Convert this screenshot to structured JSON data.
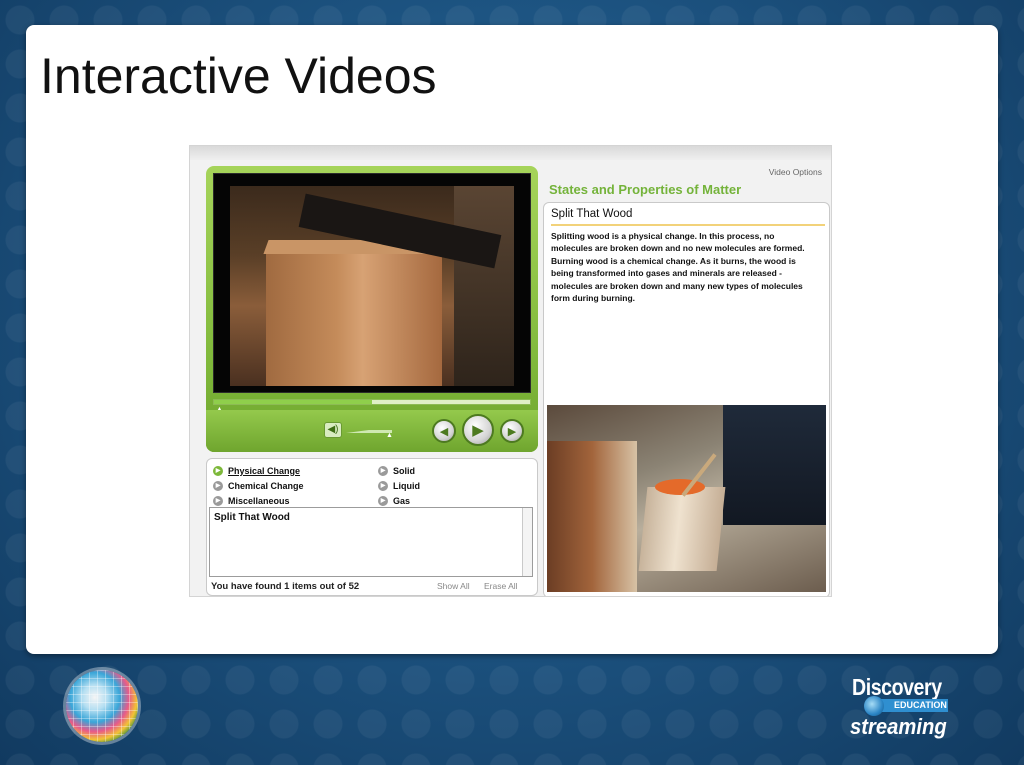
{
  "slide": {
    "title": "Interactive Videos"
  },
  "player": {
    "progress_fraction": 0.5,
    "chapters": [
      {
        "label": "Physical Change",
        "active": true
      },
      {
        "label": "Solid",
        "active": false
      },
      {
        "label": "Chemical Change",
        "active": false
      },
      {
        "label": "Liquid",
        "active": false
      },
      {
        "label": "Miscellaneous",
        "active": false
      },
      {
        "label": "Gas",
        "active": false
      }
    ],
    "notes_text": "Split That Wood",
    "found_text": "You have found 1 items out of 52",
    "show_all_label": "Show All",
    "erase_all_label": "Erase All"
  },
  "info": {
    "video_options_label": "Video Options",
    "topic_title": "States and Properties of Matter",
    "clip_title": "Split That Wood",
    "clip_description": "Splitting wood is a physical change. In this process, no molecules are broken down and no new molecules are formed. Burning wood is a chemical change. As it burns, the wood is being transformed into gases and minerals are released - molecules are broken down and many new types of molecules form during burning."
  },
  "brand": {
    "line1": "Discovery",
    "line2": "EDUCATION",
    "line3": "streaming"
  },
  "colors": {
    "accent_green": "#74b33a",
    "player_green": "#7fb83a",
    "slide_bg": "#1d5482"
  },
  "icons": {
    "volume": "speaker-icon",
    "prev": "rewind-icon",
    "play": "play-icon",
    "next": "forward-icon"
  }
}
